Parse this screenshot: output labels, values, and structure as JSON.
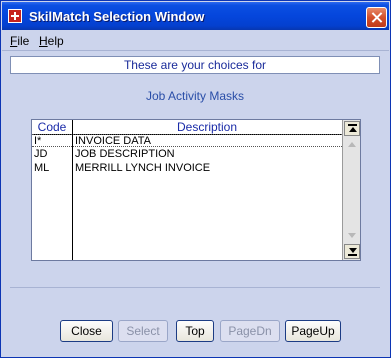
{
  "window": {
    "title": "SkilMatch Selection Window"
  },
  "menu": {
    "file": "ile",
    "file_hotkey": "F",
    "help": "elp",
    "help_hotkey": "H"
  },
  "header": {
    "text": "These are your choices for"
  },
  "subtitle": "Job Activity Masks",
  "table": {
    "columns": {
      "code": "Code",
      "description": "Description"
    },
    "rows": [
      {
        "code": "I*",
        "description": "INVOICE DATA"
      },
      {
        "code": "JD",
        "description": "JOB DESCRIPTION"
      },
      {
        "code": "ML",
        "description": "MERRILL LYNCH INVOICE"
      }
    ]
  },
  "buttons": {
    "close": "Close",
    "select": "Select",
    "top": "Top",
    "pagedn": "PageDn",
    "pageup": "PageUp"
  }
}
